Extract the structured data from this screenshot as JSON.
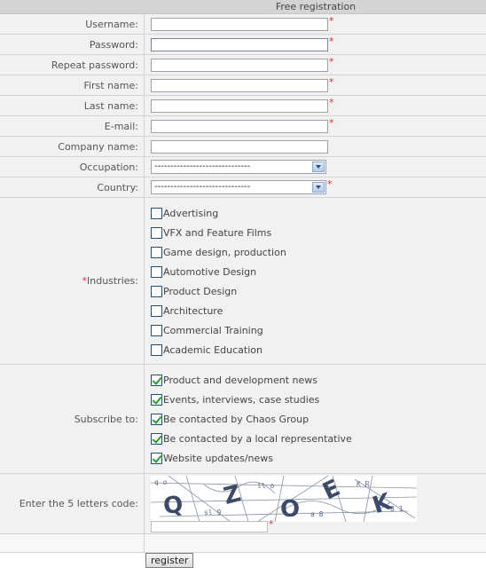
{
  "header": {
    "title": "Free registration"
  },
  "fields": [
    {
      "label": "Username:",
      "required": true
    },
    {
      "label": "Password:",
      "required": true
    },
    {
      "label": "Repeat password:",
      "required": true
    },
    {
      "label": "First name:",
      "required": true
    },
    {
      "label": "Last name:",
      "required": true
    },
    {
      "label": "E-mail:",
      "required": true
    },
    {
      "label": "Company name:",
      "required": false
    }
  ],
  "occupation": {
    "label": "Occupation:",
    "value": "------------------------------"
  },
  "country": {
    "label": "Country:",
    "value": "------------------------------",
    "required": true
  },
  "industries": {
    "required_mark": "*",
    "label": "Industries:",
    "options": [
      {
        "label": "Advertising",
        "checked": false
      },
      {
        "label": "VFX and Feature Films",
        "checked": false
      },
      {
        "label": "Game design, production",
        "checked": false
      },
      {
        "label": "Automotive Design",
        "checked": false
      },
      {
        "label": "Product Design",
        "checked": false
      },
      {
        "label": "Architecture",
        "checked": false
      },
      {
        "label": "Commercial Training",
        "checked": false
      },
      {
        "label": "Academic Education",
        "checked": false
      }
    ]
  },
  "subscribe": {
    "label": "Subscribe to:",
    "options": [
      {
        "label": "Product and development news",
        "checked": true
      },
      {
        "label": "Events, interviews, case studies",
        "checked": true
      },
      {
        "label": "Be contacted by Chaos Group",
        "checked": true
      },
      {
        "label": "Be contacted by a local representative",
        "checked": true
      },
      {
        "label": "Website updates/news",
        "checked": true
      }
    ]
  },
  "captcha": {
    "label": "Enter the 5 letters code:",
    "letters": "QZOEK"
  },
  "required_star": "*",
  "submit": {
    "label": "register"
  },
  "colors": {
    "required": "#e03030",
    "check": "#21a121",
    "row_bg": "#f1f1f1",
    "header_bg": "#d4d4d4"
  }
}
